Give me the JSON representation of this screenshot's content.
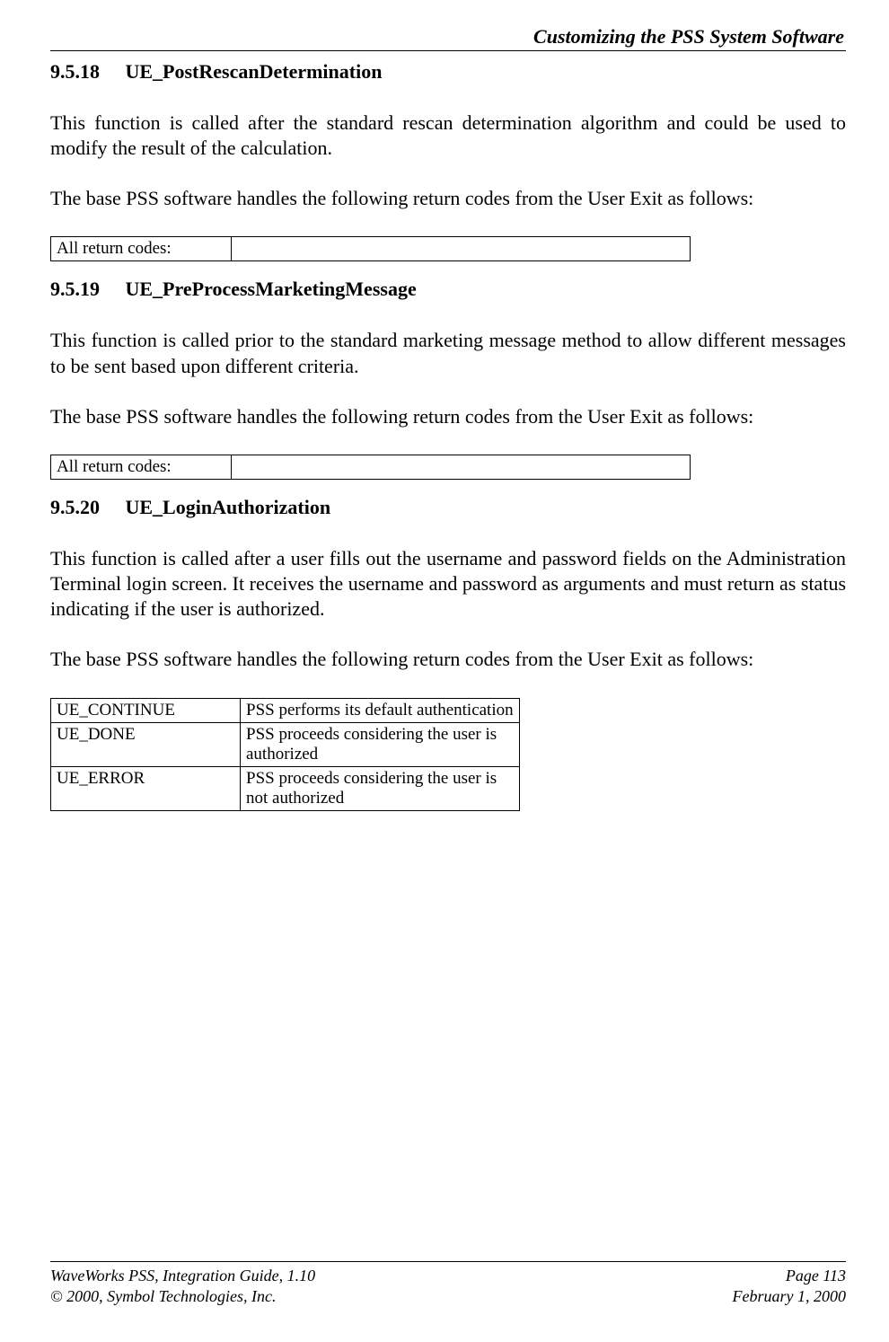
{
  "header": {
    "title": "Customizing the PSS System Software"
  },
  "sections": [
    {
      "num": "9.5.18",
      "title": "UE_PostRescanDetermination",
      "paras": [
        "This function is called after the standard rescan determination algorithm and could be used to modify the result of the calculation.",
        "The base PSS software handles the following return codes from the User Exit as follows:"
      ],
      "table": [
        {
          "code": "All return codes:",
          "desc": ""
        }
      ]
    },
    {
      "num": "9.5.19",
      "title": "UE_PreProcessMarketingMessage",
      "paras": [
        "This function is called prior to the standard marketing message method to allow different messages to be sent based upon different criteria.",
        "The base PSS software handles the following return codes from the User Exit as follows:"
      ],
      "table": [
        {
          "code": "All return codes:",
          "desc": ""
        }
      ]
    },
    {
      "num": "9.5.20",
      "title": "UE_LoginAuthorization",
      "paras": [
        "This function is called after a user fills out the username and password fields on the Administration Terminal login screen.  It receives the username and password as arguments and must return as status indicating if the user is authorized.",
        "The base PSS software handles the following return codes from the User Exit as follows:"
      ],
      "table": [
        {
          "code": "UE_CONTINUE",
          "desc": "PSS performs its default authentication"
        },
        {
          "code": "UE_DONE",
          "desc": "PSS proceeds considering the user is authorized"
        },
        {
          "code": "UE_ERROR",
          "desc": "PSS proceeds considering the user is not authorized"
        }
      ]
    }
  ],
  "footer": {
    "left1": "WaveWorks PSS, Integration Guide, 1.10",
    "left2": "© 2000, Symbol Technologies, Inc.",
    "right1": "Page 113",
    "right2": "February 1, 2000"
  }
}
